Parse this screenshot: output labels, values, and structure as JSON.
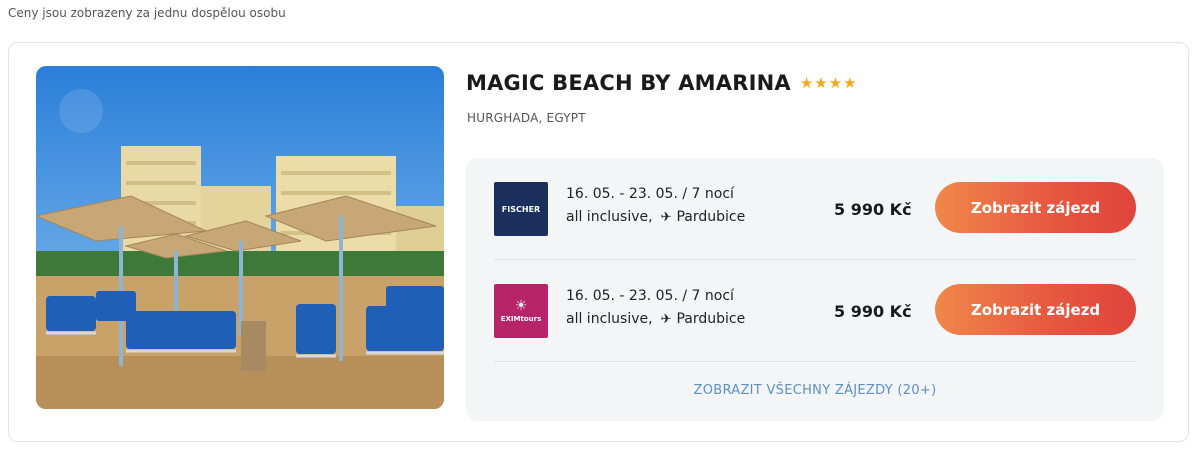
{
  "note": "Ceny jsou zobrazeny za jednu dospělou osobu",
  "hotel": {
    "name": "MAGIC BEACH BY AMARINA",
    "stars": "★★★★",
    "star_count": 4,
    "location": "HURGHADA, EGYPT"
  },
  "offers": [
    {
      "operator_logo": "FISCHER",
      "dates": "16. 05. - 23. 05. / 7 nocí",
      "board": "all inclusive,",
      "departure": "Pardubice",
      "price": "5 990 Kč",
      "button": "Zobrazit zájezd"
    },
    {
      "operator_logo": "EXIMtours",
      "dates": "16. 05. - 23. 05. / 7 nocí",
      "board": "all inclusive,",
      "departure": "Pardubice",
      "price": "5 990 Kč",
      "button": "Zobrazit zájezd"
    }
  ],
  "show_all": "ZOBRAZIT VŠECHNY ZÁJEZDY (20+)",
  "colors": {
    "accent_start": "#f0874a",
    "accent_end": "#e0443b",
    "link": "#5b90c9",
    "stars": "#f4a81c",
    "fischer": "#1b2f5e",
    "exim": "#b8246a"
  },
  "icons": {
    "plane": "plane-departure-icon"
  }
}
